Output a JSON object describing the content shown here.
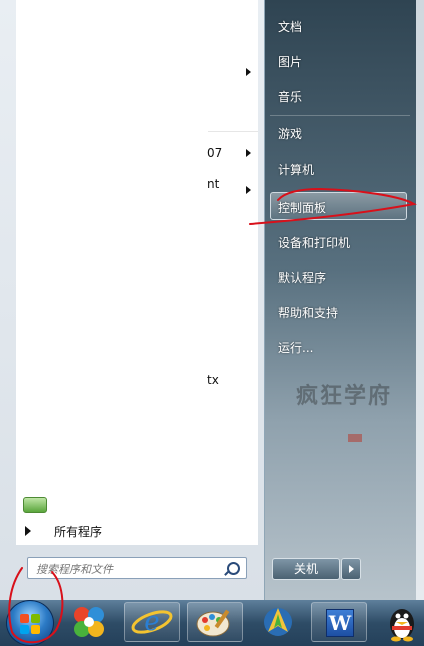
{
  "left_pane": {
    "fragments": [
      "07",
      "nt",
      "tx"
    ],
    "all_programs_label": "所有程序",
    "search_placeholder": "搜索程序和文件"
  },
  "right_pane": {
    "items": [
      "文档",
      "图片",
      "音乐",
      "游戏",
      "计算机",
      "控制面板",
      "设备和打印机",
      "默认程序",
      "帮助和支持",
      "运行..."
    ],
    "highlighted_item": "控制面板",
    "shutdown_label": "关机"
  },
  "taskbar": {
    "apps": [
      "start-orb",
      "pinwheel-app",
      "internet-explorer",
      "paint-app",
      "network-app",
      "word",
      "qq"
    ],
    "word_label": "W"
  },
  "colors": {
    "annotation_red": "#d8101a",
    "right_pane_dark": "#2f4452",
    "taskbar_dark": "#24405a"
  }
}
